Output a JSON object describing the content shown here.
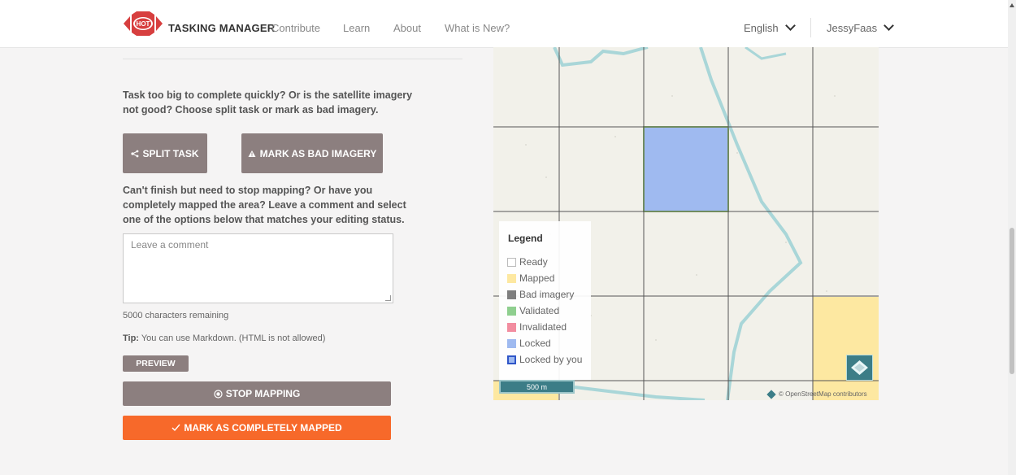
{
  "header": {
    "brand": "TASKING MANAGER",
    "logo_text": "HOT",
    "nav": [
      "Contribute",
      "Learn",
      "About",
      "What is New?"
    ],
    "language": "English",
    "user": "JessyFaas"
  },
  "panel": {
    "split_prompt": [
      "Task too big to complete quickly? Or is the satellite imagery",
      "not good? Choose split task or mark as bad imagery."
    ],
    "split_button": "SPLIT TASK",
    "bad_imagery_button": "MARK AS BAD IMAGERY",
    "stop_prompt": [
      "Can't finish but need to stop mapping? Or have you",
      "completely mapped the area? Leave a comment and select",
      "one of the options below that matches your editing status."
    ],
    "comment_placeholder": "Leave a comment",
    "chars_remaining": "5000 characters remaining",
    "tip_label": "Tip:",
    "tip_text": " You can use Markdown. (HTML is not allowed)",
    "preview_button": "PREVIEW",
    "stop_mapping_button": "STOP MAPPING",
    "completely_mapped_button": "MARK AS COMPLETELY MAPPED"
  },
  "map": {
    "legend_title": "Legend",
    "legend": [
      {
        "label": "Ready",
        "color": "#ffffff",
        "border": "#bbbbbb"
      },
      {
        "label": "Mapped",
        "color": "#fde8a1",
        "border": "#fde8a1"
      },
      {
        "label": "Bad imagery",
        "color": "#7f7f7f",
        "border": "#7f7f7f"
      },
      {
        "label": "Validated",
        "color": "#8fcf8f",
        "border": "#8fcf8f"
      },
      {
        "label": "Invalidated",
        "color": "#f28da0",
        "border": "#f28da0"
      },
      {
        "label": "Locked",
        "color": "#9fbaf0",
        "border": "#9fbaf0"
      },
      {
        "label": "Locked by you",
        "color": "#9fbaf0",
        "border": "#2f56c8"
      }
    ],
    "scale": "500 m",
    "attribution": "© OpenStreetMap contributors",
    "colors": {
      "background": "#f2f1ea",
      "grid": "#555555",
      "river": "#a9d6d8",
      "locked": "#9fbaf0",
      "mapped": "#fde8a1"
    }
  },
  "colors": {
    "accent": "#f7692a",
    "button_gray": "#8c7f7f",
    "brand_red": "#d73f3f"
  }
}
